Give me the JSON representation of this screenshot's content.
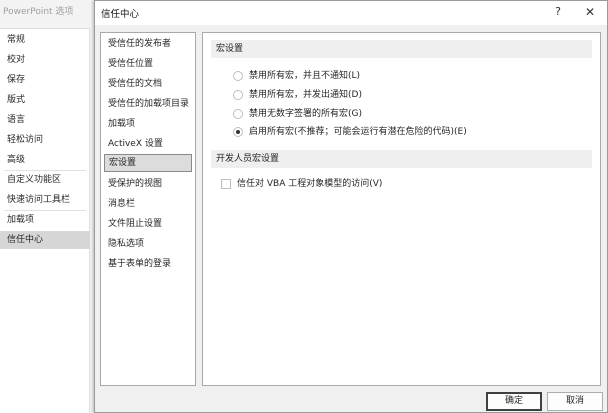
{
  "background_window": {
    "title": "PowerPoint 选项",
    "nav": [
      {
        "label": "常规"
      },
      {
        "label": "校对"
      },
      {
        "label": "保存"
      },
      {
        "label": "版式"
      },
      {
        "label": "语言"
      },
      {
        "label": "轻松访问"
      },
      {
        "label": "高级"
      },
      {
        "label": "自定义功能区"
      },
      {
        "label": "快速访问工具栏"
      },
      {
        "label": "加载项"
      },
      {
        "label": "信任中心",
        "selected": true
      }
    ]
  },
  "dialog": {
    "title": "信任中心",
    "help_glyph": "?",
    "close_glyph": "✕",
    "nav": [
      {
        "label": "受信任的发布者"
      },
      {
        "label": "受信任位置"
      },
      {
        "label": "受信任的文档"
      },
      {
        "label": "受信任的加载项目录"
      },
      {
        "label": "加载项"
      },
      {
        "label": "ActiveX 设置"
      },
      {
        "label": "宏设置",
        "selected": true
      },
      {
        "label": "受保护的视图"
      },
      {
        "label": "消息栏"
      },
      {
        "label": "文件阻止设置"
      },
      {
        "label": "隐私选项"
      },
      {
        "label": "基于表单的登录"
      }
    ],
    "macro_section": {
      "header": "宏设置",
      "options": [
        {
          "label": "禁用所有宏，并且不通知(L)",
          "checked": false
        },
        {
          "label": "禁用所有宏，并发出通知(D)",
          "checked": false
        },
        {
          "label": "禁用无数字签署的所有宏(G)",
          "checked": false
        },
        {
          "label": "启用所有宏(不推荐；可能会运行有潜在危险的代码)(E)",
          "checked": true
        }
      ]
    },
    "developer_section": {
      "header": "开发人员宏设置",
      "vba_access": {
        "label": "信任对 VBA 工程对象模型的访问(V)",
        "checked": false
      }
    },
    "ok_label": "确定",
    "cancel_label": "取消"
  }
}
